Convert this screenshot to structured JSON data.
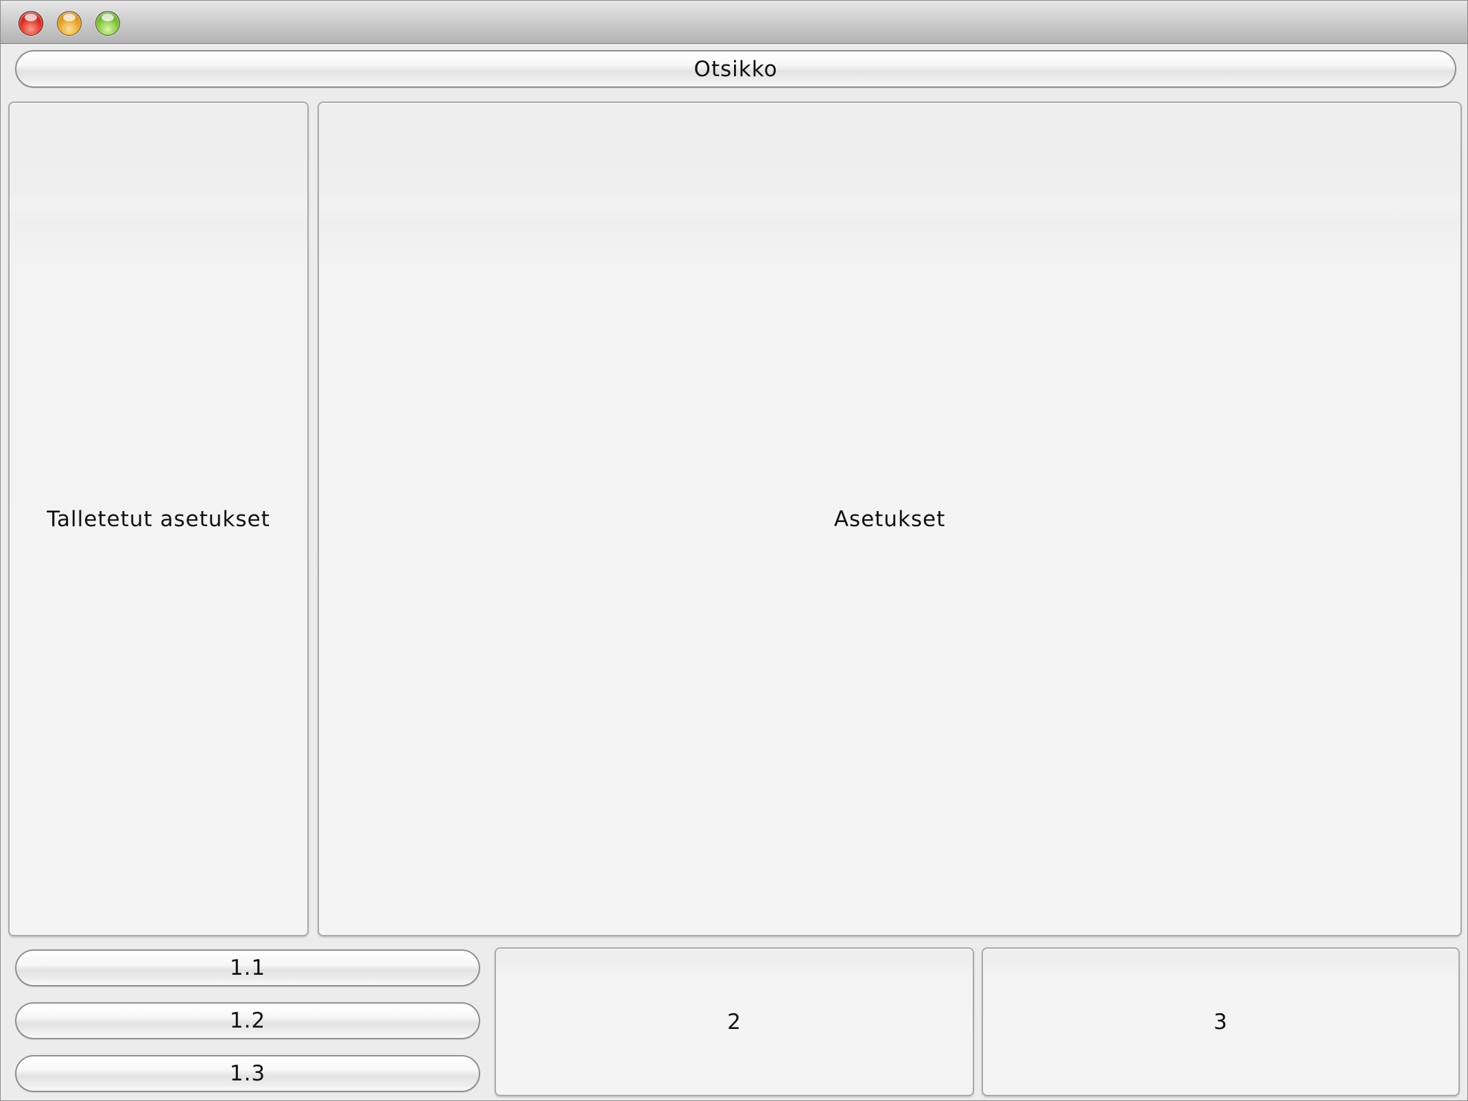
{
  "window": {
    "controls": [
      "close",
      "minimize",
      "zoom"
    ]
  },
  "header": {
    "title_button": "Otsikko"
  },
  "main": {
    "saved_settings_label": "Talletetut asetukset",
    "settings_label": "Asetukset"
  },
  "bottom": {
    "buttons": [
      "1.1",
      "1.2",
      "1.3"
    ],
    "panel_2_label": "2",
    "panel_3_label": "3"
  }
}
